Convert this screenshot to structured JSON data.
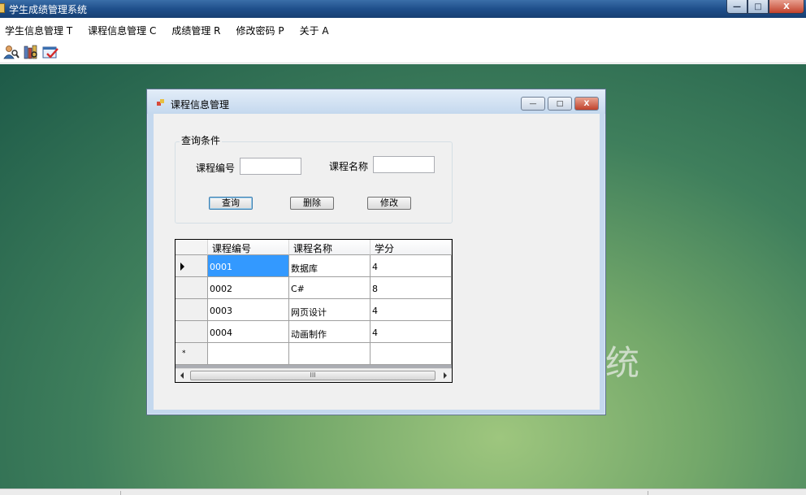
{
  "app": {
    "title": "学生成绩管理系统",
    "window_buttons": {
      "minimize": "—",
      "maximize": "□",
      "close": "X"
    }
  },
  "menu": {
    "items": [
      {
        "label": "学生信息管理 T"
      },
      {
        "label": "课程信息管理 C"
      },
      {
        "label": "成绩管理 R"
      },
      {
        "label": "修改密码 P"
      },
      {
        "label": "关于 A"
      }
    ]
  },
  "toolbar": {
    "icons": [
      "student-info-icon",
      "course-books-icon",
      "grade-check-icon"
    ]
  },
  "background": {
    "text_fragment": "统"
  },
  "child_window": {
    "title": "课程信息管理",
    "buttons": {
      "minimize": "—",
      "maximize": "□",
      "close": "X"
    },
    "query_group": {
      "legend": "查询条件",
      "course_id_label": "课程编号",
      "course_id_value": "",
      "course_name_label": "课程名称",
      "course_name_value": "",
      "query_button": "查询",
      "delete_button": "删除",
      "edit_button": "修改"
    },
    "grid": {
      "columns": [
        "课程编号",
        "课程名称",
        "学分"
      ],
      "rows": [
        {
          "id": "0001",
          "name": "数据库",
          "credit": "4"
        },
        {
          "id": "0002",
          "name": "C#",
          "credit": "8"
        },
        {
          "id": "0003",
          "name": "网页设计",
          "credit": "4"
        },
        {
          "id": "0004",
          "name": "动画制作",
          "credit": "4"
        }
      ],
      "new_row_marker": "*",
      "scroll_thumb_grip": "III"
    }
  },
  "colors": {
    "titlebar": "#1f4f8b",
    "selection": "#3399ff",
    "close_button": "#c2412b"
  }
}
